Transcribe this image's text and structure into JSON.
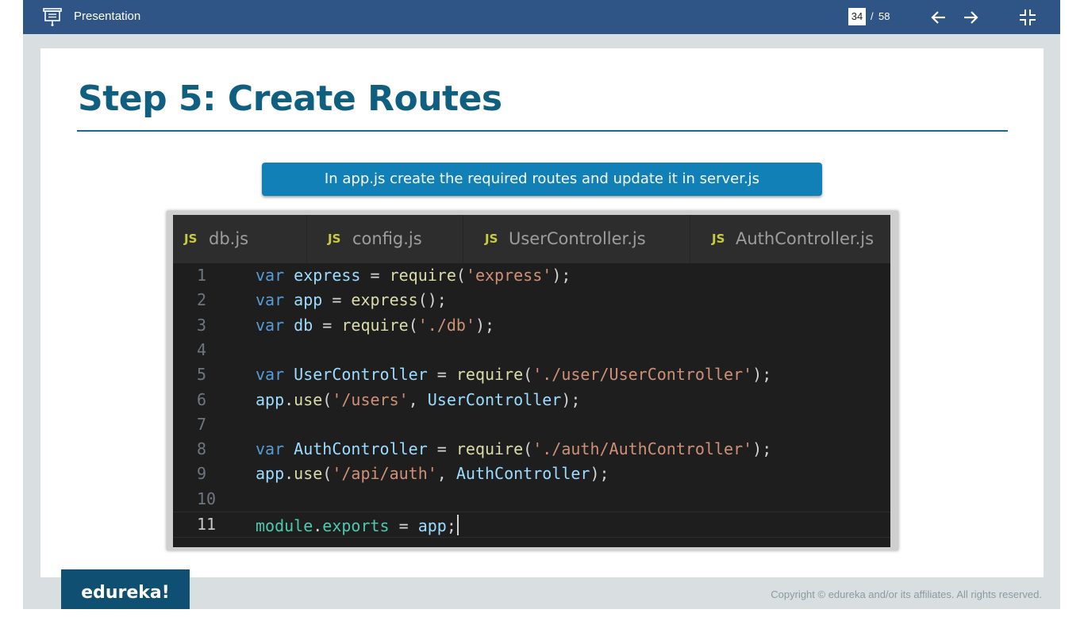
{
  "window": {
    "title": "Presentation",
    "current_page": "34",
    "page_separator": "/",
    "total_pages": "58",
    "icons": {
      "presentation": "presentation-screen-icon",
      "previous": "arrow-left-icon",
      "next": "arrow-right-icon",
      "exit_fullscreen": "exit-fullscreen-icon"
    },
    "colors": {
      "topbar": "#2f5586",
      "viewer_background": "#d9dfe1"
    }
  },
  "slide": {
    "title": "Step 5: Create Routes",
    "callout": "In app.js create the required routes and update it in server.js",
    "colors": {
      "title": "#0f5f80",
      "callout": "#1180b6"
    },
    "editor": {
      "tabs": [
        {
          "badge": "JS",
          "label": "db.js"
        },
        {
          "badge": "JS",
          "label": "config.js"
        },
        {
          "badge": "JS",
          "label": "UserController.js"
        },
        {
          "badge": "JS",
          "label": "AuthController.js"
        }
      ],
      "lines": [
        {
          "number": "1",
          "tokens": [
            [
              "kw",
              "var"
            ],
            [
              "plain",
              " "
            ],
            [
              "var",
              "express"
            ],
            [
              "plain",
              " = "
            ],
            [
              "fn",
              "require"
            ],
            [
              "plain",
              "("
            ],
            [
              "str",
              "'express'"
            ],
            [
              "plain",
              ");"
            ]
          ]
        },
        {
          "number": "2",
          "tokens": [
            [
              "kw",
              "var"
            ],
            [
              "plain",
              " "
            ],
            [
              "var",
              "app"
            ],
            [
              "plain",
              " = "
            ],
            [
              "fn",
              "express"
            ],
            [
              "plain",
              "();"
            ]
          ]
        },
        {
          "number": "3",
          "tokens": [
            [
              "kw",
              "var"
            ],
            [
              "plain",
              " "
            ],
            [
              "var",
              "db"
            ],
            [
              "plain",
              " = "
            ],
            [
              "fn",
              "require"
            ],
            [
              "plain",
              "("
            ],
            [
              "str",
              "'./db'"
            ],
            [
              "plain",
              ");"
            ]
          ]
        },
        {
          "number": "4",
          "tokens": []
        },
        {
          "number": "5",
          "tokens": [
            [
              "kw",
              "var"
            ],
            [
              "plain",
              " "
            ],
            [
              "var",
              "UserController"
            ],
            [
              "plain",
              " = "
            ],
            [
              "fn",
              "require"
            ],
            [
              "plain",
              "("
            ],
            [
              "str",
              "'./user/UserController'"
            ],
            [
              "plain",
              ");"
            ]
          ]
        },
        {
          "number": "6",
          "tokens": [
            [
              "var",
              "app"
            ],
            [
              "plain",
              "."
            ],
            [
              "fn",
              "use"
            ],
            [
              "plain",
              "("
            ],
            [
              "str",
              "'/users'"
            ],
            [
              "plain",
              ", "
            ],
            [
              "var",
              "UserController"
            ],
            [
              "plain",
              ");"
            ]
          ]
        },
        {
          "number": "7",
          "tokens": []
        },
        {
          "number": "8",
          "tokens": [
            [
              "kw",
              "var"
            ],
            [
              "plain",
              " "
            ],
            [
              "var",
              "AuthController"
            ],
            [
              "plain",
              " = "
            ],
            [
              "fn",
              "require"
            ],
            [
              "plain",
              "("
            ],
            [
              "str",
              "'./auth/AuthController'"
            ],
            [
              "plain",
              ");"
            ]
          ]
        },
        {
          "number": "9",
          "tokens": [
            [
              "var",
              "app"
            ],
            [
              "plain",
              "."
            ],
            [
              "fn",
              "use"
            ],
            [
              "plain",
              "("
            ],
            [
              "str",
              "'/api/auth'"
            ],
            [
              "plain",
              ", "
            ],
            [
              "var",
              "AuthController"
            ],
            [
              "plain",
              ");"
            ]
          ]
        },
        {
          "number": "10",
          "tokens": []
        },
        {
          "number": "11",
          "tokens": [
            [
              "mod",
              "module"
            ],
            [
              "plain",
              "."
            ],
            [
              "mod",
              "exports"
            ],
            [
              "plain",
              " = "
            ],
            [
              "var",
              "app"
            ],
            [
              "plain",
              ";"
            ]
          ],
          "active": true
        }
      ]
    }
  },
  "footer": {
    "brand": "edureka!",
    "copyright": "Copyright © edureka and/or its affiliates. All rights reserved."
  }
}
